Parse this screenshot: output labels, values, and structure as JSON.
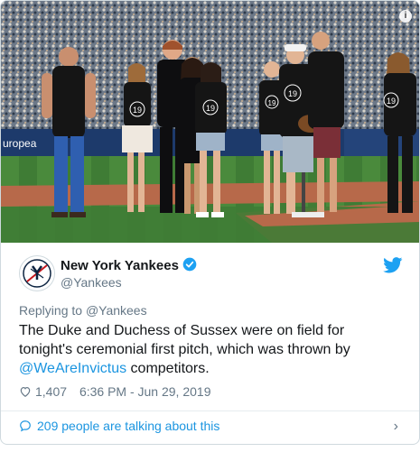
{
  "account": {
    "name": "New York Yankees",
    "handle": "@Yankees"
  },
  "tweet": {
    "replying_prefix": "Replying to",
    "replying_to": "@Yankees",
    "text_before": "The Duke and Duchess of Sussex were on field for tonight's ceremonial first pitch, which was thrown by",
    "mention": "@WeAreInvictus",
    "text_after": "competitors.",
    "likes": "1,407",
    "time": "6:36 PM - Jun 29, 2019"
  },
  "photo": {
    "jersey_number": "19",
    "banner_text": "uropea"
  },
  "footer": {
    "talking": "209 people are talking about this"
  },
  "colors": {
    "link": "#1b95e0",
    "muted": "#657786",
    "text": "#14171a",
    "border": "#cfd9de",
    "grass": "#3f7c35",
    "dirt": "#b7694a"
  },
  "icons": [
    "info-icon",
    "avatar-yankees-logo",
    "verified-badge-icon",
    "twitter-bird-icon",
    "heart-icon",
    "speech-bubble-icon",
    "chevron-right-icon"
  ]
}
